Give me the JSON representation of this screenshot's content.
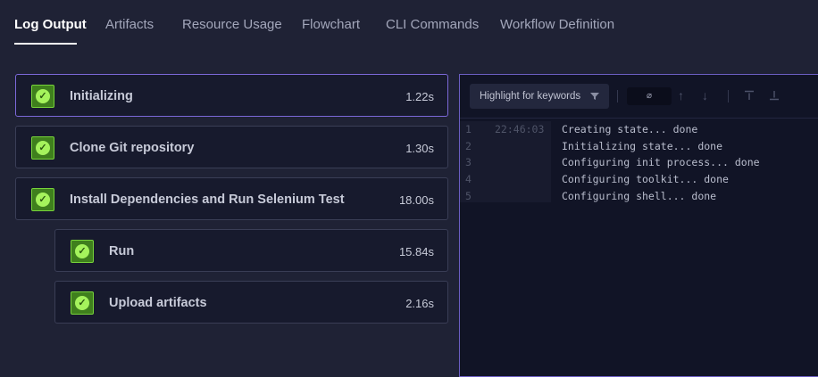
{
  "tabs": [
    {
      "label": "Log Output",
      "active": true
    },
    {
      "label": "Artifacts"
    },
    {
      "label": "Resource Usage"
    },
    {
      "label": "Flowchart"
    },
    {
      "label": "CLI Commands"
    },
    {
      "label": "Workflow Definition"
    }
  ],
  "steps": [
    {
      "name": "Initializing",
      "time": "1.22s",
      "status": "success",
      "icon": "check-circle-icon"
    },
    {
      "name": "Clone Git repository",
      "time": "1.30s",
      "status": "success",
      "icon": "check-circle-icon"
    },
    {
      "name": "Install Dependencies and Run Selenium Test",
      "time": "18.00s",
      "status": "success",
      "icon": "check-circle-icon"
    },
    {
      "name": "Run",
      "time": "15.84s",
      "status": "success",
      "icon": "check-circle-icon"
    },
    {
      "name": "Upload artifacts",
      "time": "2.16s",
      "status": "success",
      "icon": "check-circle-icon"
    }
  ],
  "log_toolbar": {
    "highlight_placeholder": "Highlight for keywords",
    "search_value": "⌀",
    "icons": [
      "filter-icon",
      "arrow-up-icon",
      "arrow-down-icon",
      "scroll-top-icon",
      "scroll-bottom-icon"
    ]
  },
  "log_lines": [
    {
      "num": "1",
      "time": "22:46:03",
      "text": "Creating state... done"
    },
    {
      "num": "2",
      "time": "",
      "text": "Initializing state... done"
    },
    {
      "num": "3",
      "time": "",
      "text": "Configuring init process... done"
    },
    {
      "num": "4",
      "time": "",
      "text": "Configuring toolkit... done"
    },
    {
      "num": "5",
      "time": "",
      "text": "Configuring shell... done"
    }
  ],
  "colors": {
    "background": "#1f2235",
    "selected_border": "#7b68d8",
    "success_green": "#a5f35c"
  }
}
